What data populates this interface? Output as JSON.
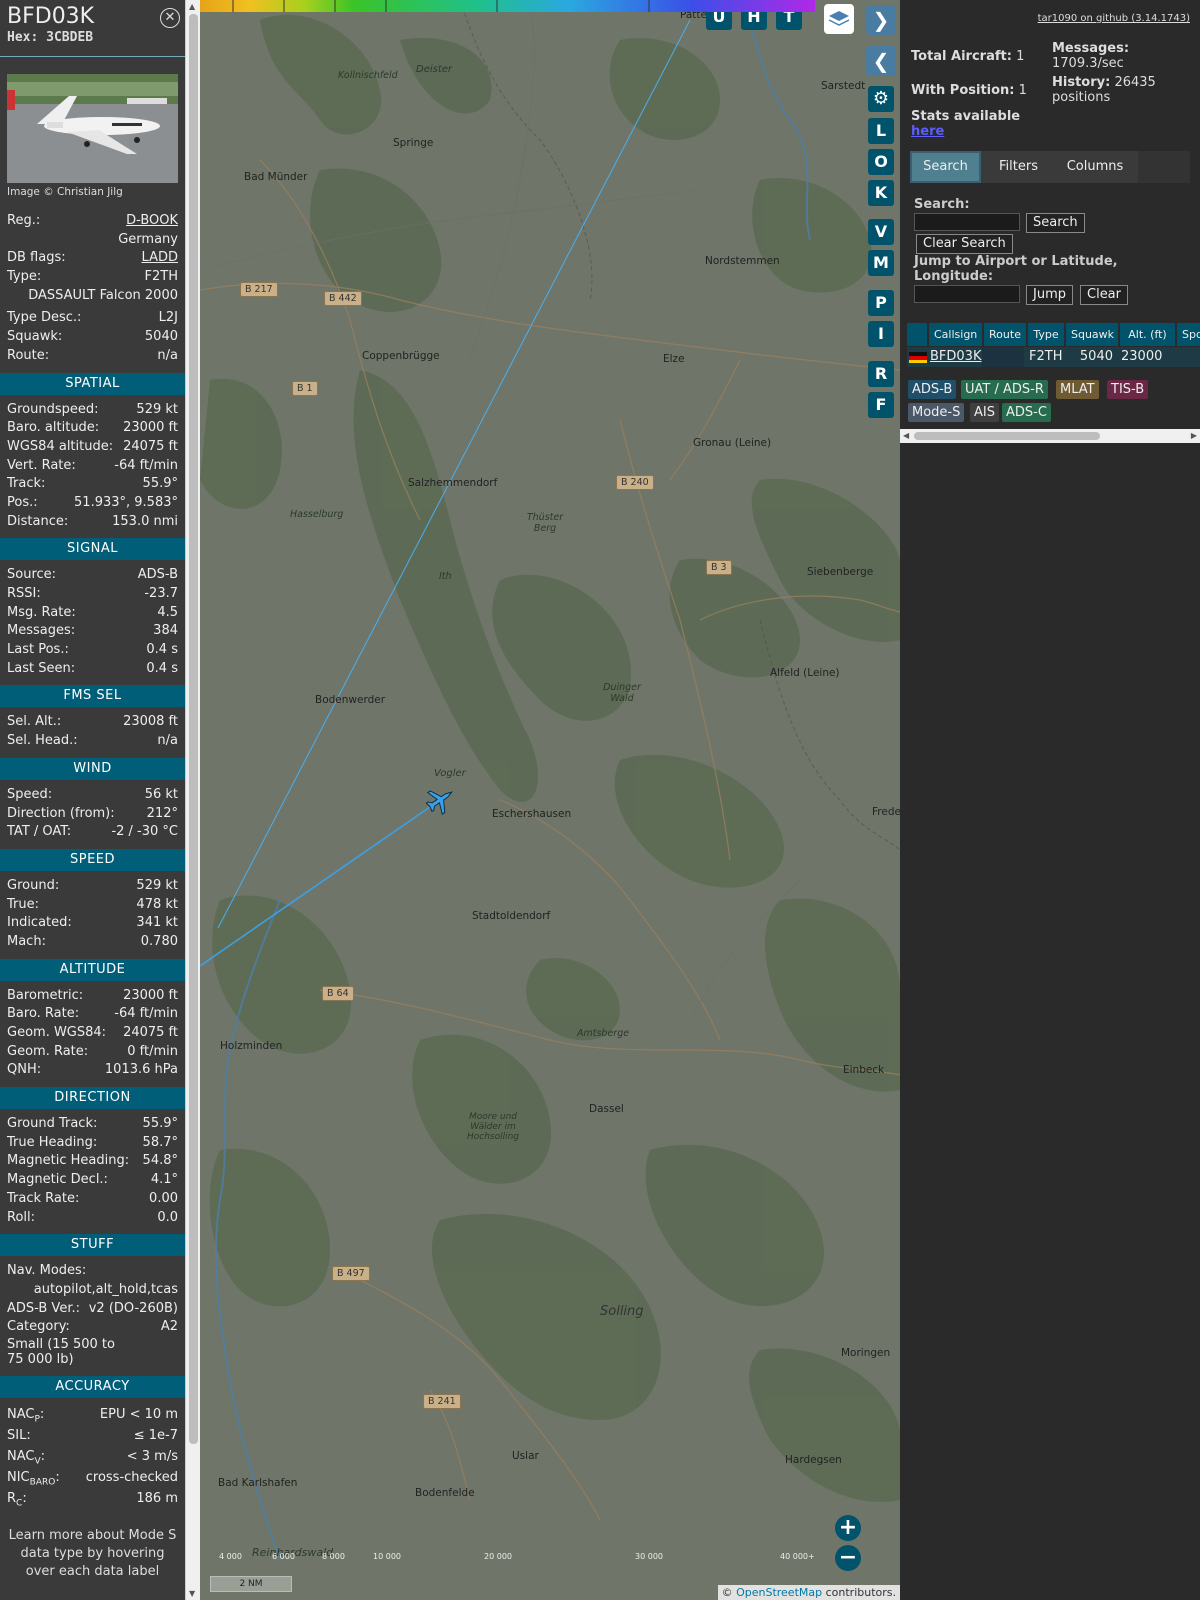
{
  "info": {
    "callsign": "BFD03K",
    "hex": "Hex: 3CBDEB",
    "credit": "Image © Christian Jilg",
    "top_rows": [
      {
        "k": "Reg.:",
        "v": "D-BOOK",
        "link": true
      },
      {
        "k": "",
        "v": "Germany"
      },
      {
        "k": "DB flags:",
        "v": "LADD",
        "link": true
      },
      {
        "k": "Type:",
        "v": "F2TH"
      },
      {
        "k": "",
        "v": "DASSAULT Falcon 2000"
      },
      {
        "k": "Type Desc.:",
        "v": "L2J"
      },
      {
        "k": "Squawk:",
        "v": "5040"
      },
      {
        "k": "Route:",
        "v": "n/a"
      }
    ],
    "sections": {
      "spatial": {
        "title": "SPATIAL",
        "rows": [
          {
            "k": "Groundspeed:",
            "v": "529 kt"
          },
          {
            "k": "Baro. altitude:",
            "v": "23000 ft"
          },
          {
            "k": "WGS84 altitude:",
            "v": "24075 ft"
          },
          {
            "k": "Vert. Rate:",
            "v": "-64 ft/min"
          },
          {
            "k": "Track:",
            "v": "55.9°"
          },
          {
            "k": "Pos.:",
            "v": "51.933°, 9.583°"
          },
          {
            "k": "Distance:",
            "v": "153.0 nmi"
          }
        ]
      },
      "signal": {
        "title": "SIGNAL",
        "rows": [
          {
            "k": "Source:",
            "v": "ADS-B"
          },
          {
            "k": "RSSI:",
            "v": "-23.7"
          },
          {
            "k": "Msg. Rate:",
            "v": "4.5"
          },
          {
            "k": "Messages:",
            "v": "384"
          },
          {
            "k": "Last Pos.:",
            "v": "0.4 s"
          },
          {
            "k": "Last Seen:",
            "v": "0.4 s"
          }
        ]
      },
      "fms": {
        "title": "FMS SEL",
        "rows": [
          {
            "k": "Sel. Alt.:",
            "v": "23008 ft"
          },
          {
            "k": "Sel. Head.:",
            "v": "n/a"
          }
        ]
      },
      "wind": {
        "title": "WIND",
        "rows": [
          {
            "k": "Speed:",
            "v": "56 kt"
          },
          {
            "k": "Direction (from):",
            "v": "212°"
          },
          {
            "k": "TAT / OAT:",
            "v": "-2 / -30 °C"
          }
        ]
      },
      "speed": {
        "title": "SPEED",
        "rows": [
          {
            "k": "Ground:",
            "v": "529 kt"
          },
          {
            "k": "True:",
            "v": "478 kt"
          },
          {
            "k": "Indicated:",
            "v": "341 kt"
          },
          {
            "k": "Mach:",
            "v": "0.780"
          }
        ]
      },
      "altitude": {
        "title": "ALTITUDE",
        "rows": [
          {
            "k": "Barometric:",
            "v": "23000 ft"
          },
          {
            "k": "Baro. Rate:",
            "v": "-64 ft/min"
          },
          {
            "k": "Geom. WGS84:",
            "v": "24075 ft"
          },
          {
            "k": "Geom. Rate:",
            "v": "0 ft/min"
          },
          {
            "k": "QNH:",
            "v": "1013.6 hPa"
          }
        ]
      },
      "direction": {
        "title": "DIRECTION",
        "rows": [
          {
            "k": "Ground Track:",
            "v": "55.9°"
          },
          {
            "k": "True Heading:",
            "v": "58.7°"
          },
          {
            "k": "Magnetic Heading:",
            "v": "54.8°"
          },
          {
            "k": "Magnetic Decl.:",
            "v": "4.1°"
          },
          {
            "k": "Track Rate:",
            "v": "0.00"
          },
          {
            "k": "Roll:",
            "v": "0.0"
          }
        ]
      },
      "stuff": {
        "title": "STUFF",
        "nav_label": "Nav. Modes:",
        "nav_value": "autopilot,alt_hold,tcas",
        "adsb_label": "ADS-B Ver.:",
        "adsb_value": "v2 (DO-260B)",
        "cat_label": "Category:",
        "cat_value": "A2",
        "cat_desc1": "Small (15 500 to",
        "cat_desc2": "75 000 lb)"
      },
      "accuracy": {
        "title": "ACCURACY",
        "nacp_label": "NAC",
        "nacp_sub": "P",
        "nacp_value": "EPU < 10 m",
        "sil_label": "SIL:",
        "sil_value": "≤ 1e-7",
        "nacv_label": "NAC",
        "nacv_sub": "V",
        "nacv_value": "< 3 m/s",
        "nicbaro_label": "NIC",
        "nicbaro_sub": "BARO",
        "nicbaro_value": "cross-checked",
        "rc_label": "R",
        "rc_sub": "C",
        "rc_value": "186 m"
      },
      "footer_note": "Learn more about Mode S data type by hovering over each data label"
    }
  },
  "map": {
    "buttons": [
      "U",
      "H",
      "T"
    ],
    "side_buttons": [
      "L",
      "O",
      "K",
      "V",
      "M",
      "P",
      "I",
      "R",
      "F"
    ],
    "places": [
      {
        "name": "Deister",
        "cls": "it2"
      },
      {
        "name": "Kollnischfeld"
      },
      {
        "name": "Springe"
      },
      {
        "name": "Bad Münder"
      },
      {
        "name": "Coppenbrügge"
      },
      {
        "name": "Salzhemmendorf"
      },
      {
        "name": "Hasselburg"
      },
      {
        "name": "Thüster Berg"
      },
      {
        "name": "Ith"
      },
      {
        "name": "Bodenwerder"
      },
      {
        "name": "Vogler"
      },
      {
        "name": "Eschershausen"
      },
      {
        "name": "Duinger Wald"
      },
      {
        "name": "Stadtoldendorf"
      },
      {
        "name": "Holzminden"
      },
      {
        "name": "Amtsberge"
      },
      {
        "name": "Dassel"
      },
      {
        "name": "Moore und Wälder im Hochsolling"
      },
      {
        "name": "Solling"
      },
      {
        "name": "Uslar"
      },
      {
        "name": "Bodenfelde"
      },
      {
        "name": "Bad Karlshafen"
      },
      {
        "name": "Reinhardswald"
      },
      {
        "name": "Nordstemmen"
      },
      {
        "name": "Elze"
      },
      {
        "name": "Gronau (Leine)"
      },
      {
        "name": "Siebenberge"
      },
      {
        "name": "Alfeld (Leine)"
      },
      {
        "name": "Einbeck"
      },
      {
        "name": "Moringen"
      },
      {
        "name": "Hardegsen"
      },
      {
        "name": "Sarstedt"
      },
      {
        "name": "Patte"
      },
      {
        "name": "Frede"
      }
    ],
    "roads": [
      "B 217",
      "B 442",
      "B 1",
      "B 240",
      "B 3",
      "B 64",
      "B 497",
      "B 241"
    ],
    "legend_ticks": [
      "4 000",
      "6 000",
      "8 000",
      "10 000",
      "20 000",
      "30 000",
      "40 000+"
    ],
    "scale": "2 NM",
    "attribution_prefix": "© ",
    "attribution_link": "OpenStreetMap",
    "attribution_suffix": " contributors.",
    "colors": {
      "track": "#3aa0e8",
      "aircraft": "#3aa0e8",
      "water": "#4d7ea8"
    }
  },
  "side": {
    "github_link": "tar1090 on github (3.14.1743)",
    "total_label": "Total Aircraft:",
    "total_value": "1",
    "withpos_label": "With Position:",
    "withpos_value": "1",
    "messages_label": "Messages:",
    "messages_value": "1709.3/sec",
    "history_label": "History:",
    "history_value": "26435",
    "history_unit": "positions",
    "stats_label": "Stats available",
    "stats_link": "here",
    "tabs": [
      "Search",
      "Filters",
      "Columns"
    ],
    "search_label": "Search:",
    "search_button": "Search",
    "clear_search_button": "Clear Search",
    "jump_label": "Jump to Airport or Latitude, Longitude:",
    "jump_button": "Jump",
    "clear_button": "Clear",
    "columns": [
      "Callsign",
      "Route",
      "Type",
      "Squawk",
      "Alt. (ft)",
      "Spd."
    ],
    "row": {
      "callsign": "BFD03K",
      "route": "",
      "type": "F2TH",
      "squawk": "5040",
      "alt": "23000",
      "spd": ""
    },
    "source_pills": [
      {
        "label": "ADS-B",
        "bg": "#1f4f69"
      },
      {
        "label": "UAT / ADS-R",
        "bg": "#276c4e"
      },
      {
        "label": "MLAT",
        "bg": "#6e5a33"
      },
      {
        "label": "TIS-B",
        "bg": "#6a2846"
      },
      {
        "label": "Mode-S",
        "bg": "#4a5868"
      },
      {
        "label": "AIS",
        "bg": "#3f3f3f"
      },
      {
        "label": "ADS-C",
        "bg": "#276c4e"
      }
    ]
  }
}
